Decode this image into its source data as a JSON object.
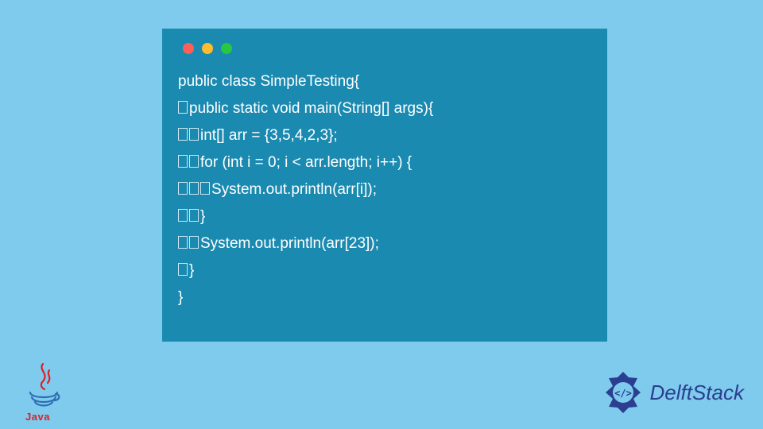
{
  "code": {
    "lines": [
      {
        "indent": 0,
        "text": "public class SimpleTesting{"
      },
      {
        "indent": 1,
        "text": "public static void main(String[] args){"
      },
      {
        "indent": 2,
        "text": "int[] arr = {3,5,4,2,3};"
      },
      {
        "indent": 2,
        "text": "for (int i = 0; i < arr.length; i++) {"
      },
      {
        "indent": 3,
        "text": "System.out.println(arr[i]);"
      },
      {
        "indent": 2,
        "text": "}"
      },
      {
        "indent": 2,
        "text": "System.out.println(arr[23]);"
      },
      {
        "indent": 1,
        "text": "}"
      },
      {
        "indent": 0,
        "text": "}"
      }
    ]
  },
  "branding": {
    "java_label": "Java",
    "delft_label": "DelftStack"
  },
  "window": {
    "dot_colors": {
      "red": "#ff5f57",
      "yellow": "#febc2e",
      "green": "#28c840"
    }
  }
}
